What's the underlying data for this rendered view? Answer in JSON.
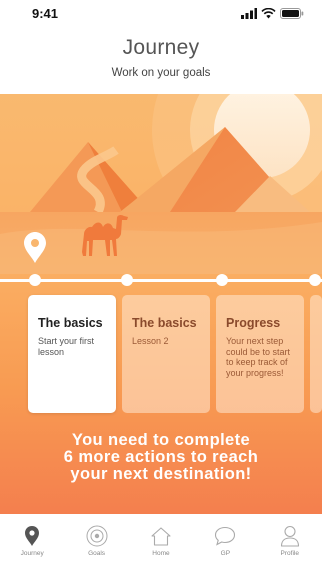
{
  "status": {
    "time": "9:41",
    "icons": [
      "signal-bars-icon",
      "wifi-icon",
      "battery-icon"
    ]
  },
  "header": {
    "title": "Journey",
    "subtitle": "Work on your goals"
  },
  "hero": {
    "icons": [
      "location-pin-icon",
      "camel-icon",
      "sun",
      "pyramids"
    ]
  },
  "cards": [
    {
      "title": "The basics",
      "text": "Start your first lesson",
      "state": "active"
    },
    {
      "title": "The basics",
      "text": "Lesson 2",
      "state": "inactive"
    },
    {
      "title": "Progress",
      "text": "Your next step could be to start to keep track of your progress!",
      "state": "inactive"
    }
  ],
  "message": {
    "line1": "You need to complete",
    "line2": "6 more actions to reach",
    "line3": "your next destination!"
  },
  "tabs": [
    {
      "label": "Journey",
      "icon": "location-pin-icon",
      "active": true
    },
    {
      "label": "Goals",
      "icon": "target-icon",
      "active": false
    },
    {
      "label": "Home",
      "icon": "home-icon",
      "active": false
    },
    {
      "label": "GP",
      "icon": "chat-bubble-icon",
      "active": false
    },
    {
      "label": "Profile",
      "icon": "user-icon",
      "active": false
    }
  ],
  "colors": {
    "gradient_top": "#f9b96f",
    "gradient_bottom": "#f47f4e",
    "text_dark": "#555555",
    "tab_active": "#555555",
    "tab_inactive": "#999999"
  }
}
